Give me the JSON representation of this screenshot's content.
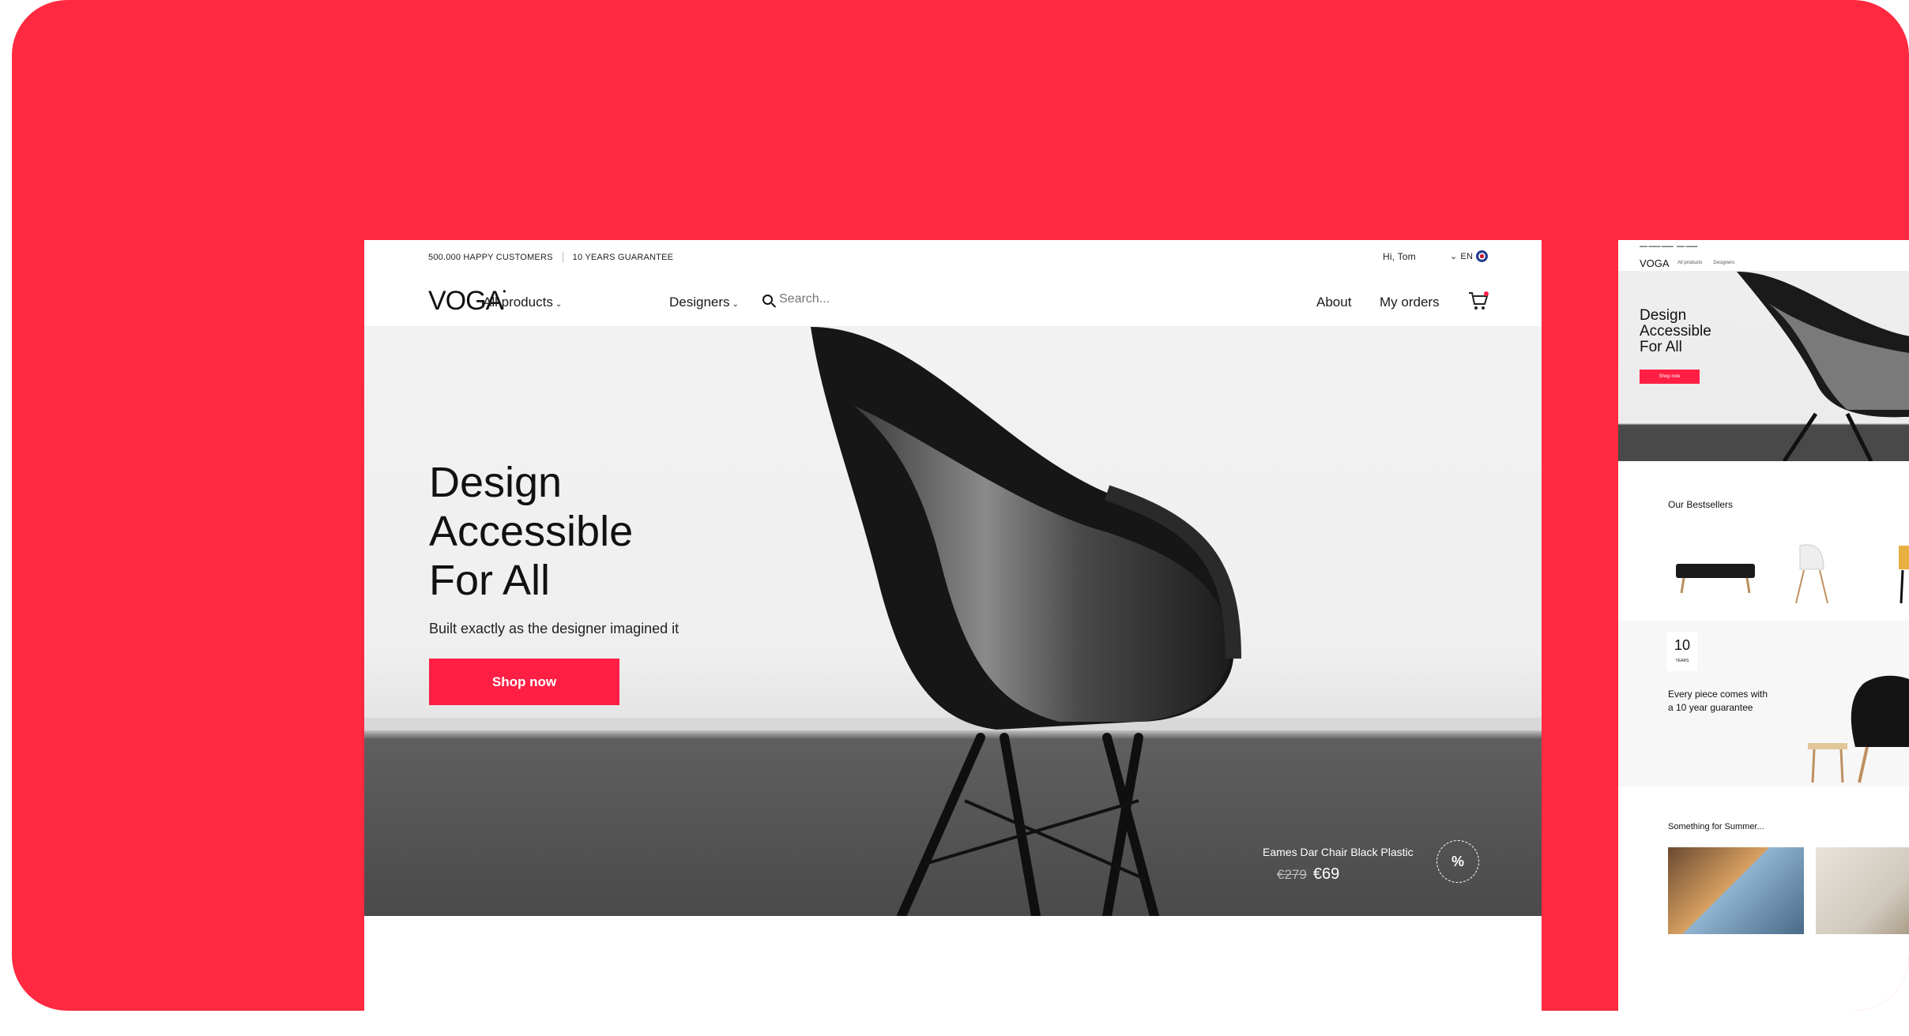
{
  "colors": {
    "brand": "#ff2a40",
    "button": "#ff1f45"
  },
  "main_site": {
    "utility_bar": {
      "customers": "500.000 HAPPY CUSTOMERS",
      "guarantee": "10 YEARS GUARANTEE",
      "greeting": "Hi, Tom",
      "language": "EN",
      "language_icon": "uk-flag-icon"
    },
    "nav": {
      "logo": "VOGA",
      "all_products": "All products",
      "designers": "Designers",
      "search_placeholder": "Search...",
      "about": "About",
      "my_orders": "My orders",
      "cart_icon": "cart-icon"
    },
    "hero": {
      "title_line1": "Design",
      "title_line2": "Accessible",
      "title_line3": "For All",
      "subtitle": "Built exactly as the designer imagined it",
      "cta": "Shop now",
      "product_name": "Eames Dar Chair Black Plastic",
      "price_old": "€279",
      "price_new": "€69",
      "badge": "%"
    }
  },
  "preview_site": {
    "logo": "VOGA",
    "nav_links": [
      "All products",
      "Designers"
    ],
    "hero": {
      "title_line1": "Design",
      "title_line2": "Accessible",
      "title_line3": "For All",
      "cta": "Shop now"
    },
    "bestsellers": {
      "title": "Our Bestsellers"
    },
    "guarantee": {
      "number": "10",
      "unit": "YEARS",
      "line1": "Every piece comes with",
      "line2": "a 10 year guarantee"
    },
    "summer": {
      "title": "Something for Summer..."
    }
  }
}
